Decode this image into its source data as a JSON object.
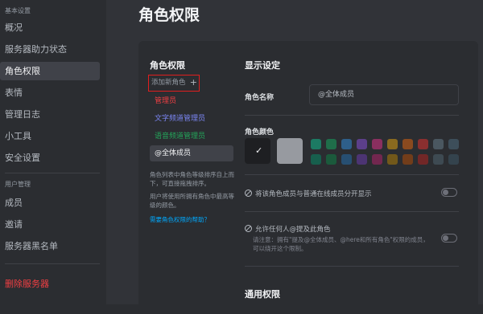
{
  "sidebar": {
    "section1_header": "基本设置",
    "items1": [
      "概况",
      "服务器助力状态",
      "角色权限",
      "表情",
      "管理日志",
      "小工具",
      "安全设置"
    ],
    "section2_header": "用户管理",
    "items2": [
      "成员",
      "邀请",
      "服务器黑名单"
    ],
    "danger_item": "删除服务器"
  },
  "main": {
    "title": "角色权限"
  },
  "roles_panel": {
    "title": "角色权限",
    "add_role_label": "添加新角色",
    "add_role_icon": "+",
    "roles": [
      {
        "label": "管理员",
        "color": "#f23f43"
      },
      {
        "label": "文字频道管理员",
        "color": "#7b86f4"
      },
      {
        "label": "语音频道管理员",
        "color": "#23a55a"
      },
      {
        "label": "@全体成员",
        "color": "#f2f3f5"
      }
    ],
    "hint1": "角色列表中角色等级排序自上而下，可直接拖拽排序。",
    "hint2": "用户将使用所拥有角色中最高等级的颜色。",
    "help_link": "需要角色权限的帮助？"
  },
  "display": {
    "section_title": "显示设定",
    "role_name_label": "角色名称",
    "role_name_value": "@全体成员",
    "role_color_label": "角色颜色",
    "selected_color": "#1e1f22",
    "custom_color": "#979aa0",
    "colors_row1": [
      "#1c7a63",
      "#1f6e4a",
      "#2e5f8a",
      "#5c3f8a",
      "#8a2f5f",
      "#8a6a1f",
      "#8a4a1f",
      "#8a2f2f",
      "#4a5760",
      "#3d4e5a"
    ],
    "colors_row2": [
      "#175f4d",
      "#1b5a3c",
      "#274f72",
      "#4c3473",
      "#72274f",
      "#72581a",
      "#723d1a",
      "#722727",
      "#3e4a52",
      "#34434d"
    ],
    "perm1_label": "将该角色成员与普通在线成员分开显示",
    "perm2_label": "允许任何人@提及此角色",
    "perm2_desc": "请注意：拥有\"提及@全体成员、@here和所有角色\"权限的成员，可以绕开这个限制。"
  },
  "general": {
    "section_title": "通用权限"
  }
}
